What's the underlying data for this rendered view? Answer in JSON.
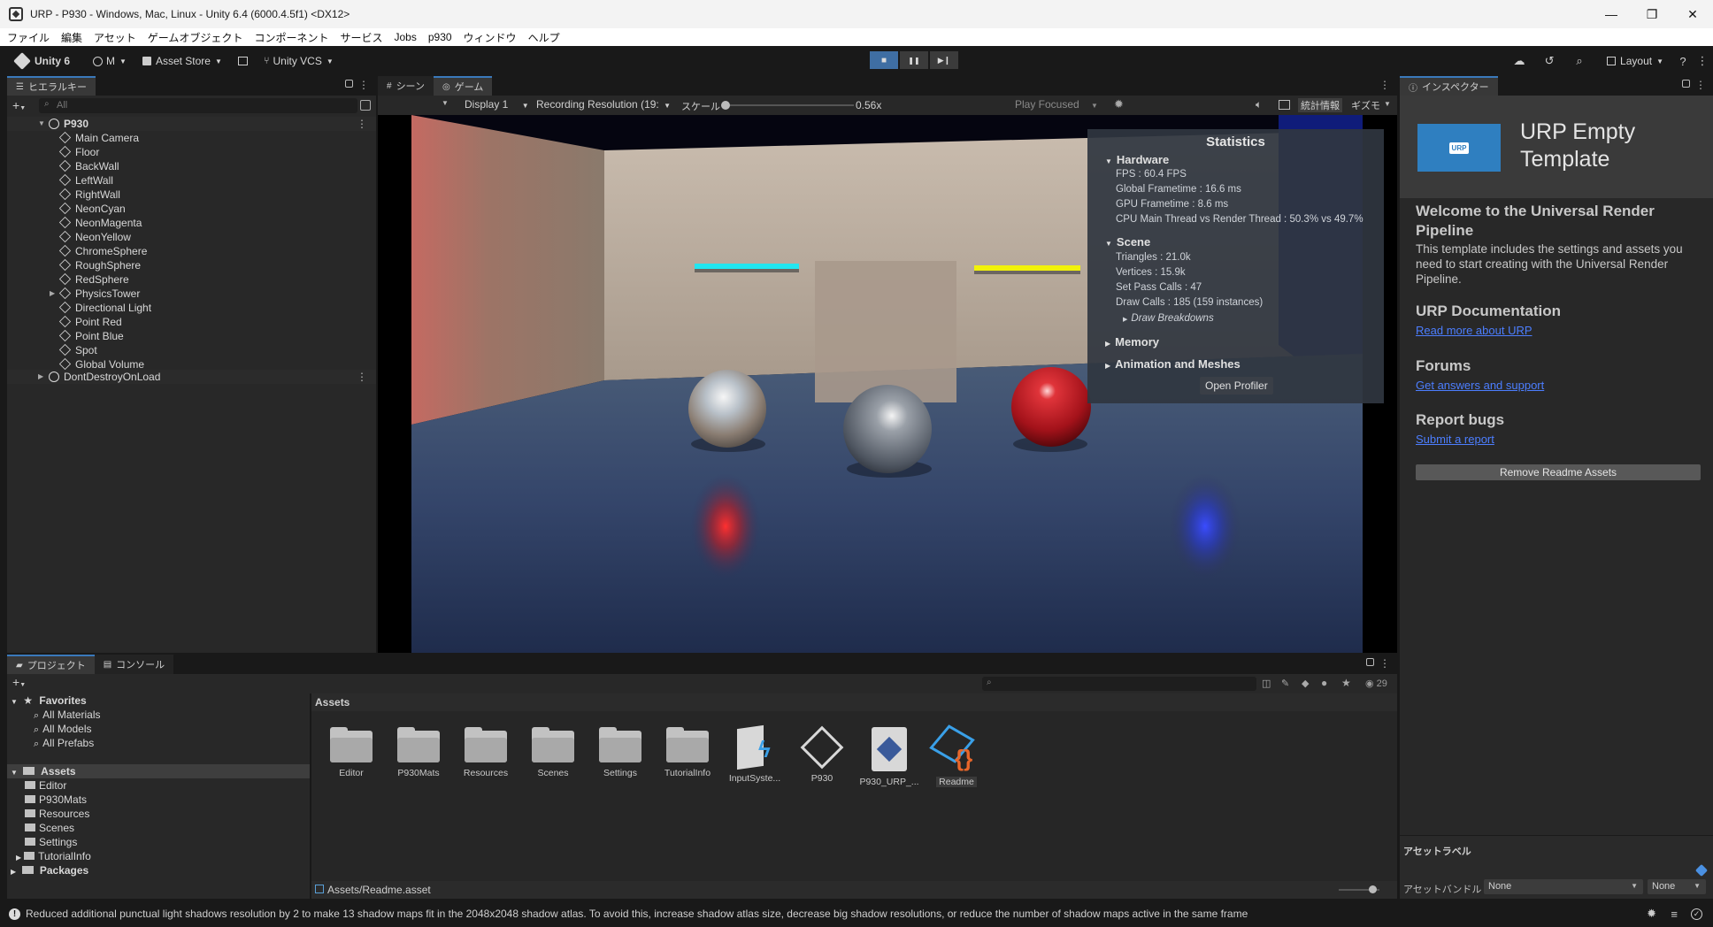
{
  "window": {
    "title": "URP - P930 - Windows, Mac, Linux - Unity 6.4 (6000.4.5f1) <DX12>",
    "minimize_glyph": "—",
    "maximize_glyph": "❐",
    "close_glyph": "✕"
  },
  "menu": [
    "ファイル",
    "編集",
    "アセット",
    "ゲームオブジェクト",
    "コンポーネント",
    "サービス",
    "Jobs",
    "p930",
    "ウィンドウ",
    "ヘルプ"
  ],
  "toolbar": {
    "unity_label": "Unity 6",
    "account_label": "M",
    "asset_store_label": "Asset Store",
    "vcs_label": "Unity VCS",
    "layout_label": "Layout",
    "play_glyph": "■",
    "pause_glyph": "❚❚",
    "step_glyph": "▶❙"
  },
  "hierarchy": {
    "tab_label": "ヒエラルキー",
    "search_placeholder": "All",
    "scene_name": "P930",
    "items": [
      "Main Camera",
      "Floor",
      "BackWall",
      "LeftWall",
      "RightWall",
      "NeonCyan",
      "NeonMagenta",
      "NeonYellow",
      "ChromeSphere",
      "RoughSphere",
      "RedSphere",
      "PhysicsTower",
      "Directional Light",
      "Point Red",
      "Point Blue",
      "Spot",
      "Global Volume"
    ],
    "ddol_scene": "DontDestroyOnLoad"
  },
  "game": {
    "scene_tab": "シーン",
    "game_tab": "ゲーム",
    "display": "Display 1",
    "resolution": "Recording Resolution (19:",
    "scale_label": "スケール",
    "scale_value": "0.56x",
    "scale_fraction": 0.0,
    "play_focused": "Play Focused",
    "stats_btn": "統計情報",
    "gizmos_btn": "ギズモ"
  },
  "stats": {
    "title": "Statistics",
    "hardware": "Hardware",
    "fps": "FPS : 60.4 FPS",
    "global_frametime": "Global Frametime : 16.6 ms",
    "gpu_frametime": "GPU Frametime : 8.6 ms",
    "cpu_thread": "CPU Main Thread vs Render Thread : 50.3% vs 49.7%",
    "scene": "Scene",
    "triangles": "Triangles : 21.0k",
    "vertices": "Vertices : 15.9k",
    "set_pass": "Set Pass Calls : 47",
    "draw_calls": "Draw Calls : 185 (159 instances)",
    "draw_breakdowns": "Draw Breakdowns",
    "memory": "Memory",
    "animation": "Animation and Meshes",
    "open_profiler": "Open Profiler"
  },
  "inspector": {
    "tab_label": "インスペクター",
    "logo_text": "URP",
    "title": "URP Empty Template",
    "welcome_heading": "Welcome to the Universal Render Pipeline",
    "welcome_body": "This template includes the settings and assets you need to start creating with the Universal Render Pipeline.",
    "doc_heading": "URP Documentation",
    "doc_link": "Read more about URP",
    "forums_heading": "Forums",
    "forums_link": "Get answers and support",
    "bugs_heading": "Report bugs",
    "bugs_link": "Submit a report",
    "remove_btn": "Remove Readme Assets",
    "asset_labels": "アセットラベル",
    "asset_bundle": "アセットバンドル",
    "bundle_value": "None",
    "variant_value": "None"
  },
  "project": {
    "tab_project": "プロジェクト",
    "tab_console": "コンソール",
    "count": "29",
    "favorites": "Favorites",
    "fav_items": [
      "All Materials",
      "All Models",
      "All Prefabs"
    ],
    "assets_root": "Assets",
    "asset_folders": [
      "Editor",
      "P930Mats",
      "Resources",
      "Scenes",
      "Settings",
      "TutorialInfo"
    ],
    "packages": "Packages",
    "breadcrumb": "Assets",
    "grid": [
      "Editor",
      "P930Mats",
      "Resources",
      "Scenes",
      "Settings",
      "TutorialInfo",
      "InputSyste...",
      "P930",
      "P930_URP_...",
      "Readme"
    ],
    "selected_path": "Assets/Readme.asset"
  },
  "status": {
    "message": "Reduced additional punctual light shadows resolution by 2 to make 13 shadow maps fit in the 2048x2048 shadow atlas. To avoid this, increase shadow atlas size, decrease big shadow resolutions, or reduce the number of shadow maps active in the same frame"
  },
  "colors": {
    "accent": "#3a79bb",
    "link": "#4c7eff",
    "neon_cyan": "#22e6f0",
    "neon_yellow": "#f2f20a",
    "red_sphere": "#c81a22"
  }
}
